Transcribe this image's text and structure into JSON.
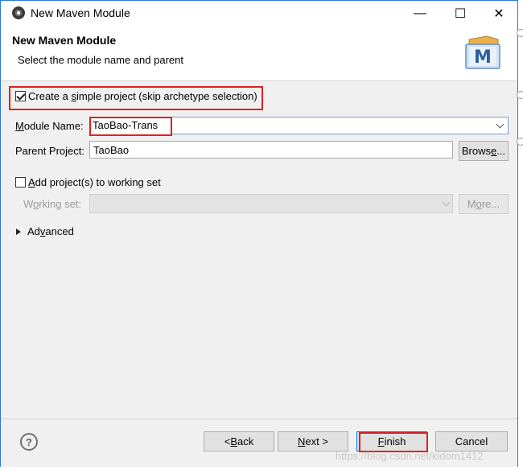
{
  "window": {
    "title": "New Maven Module",
    "controls": {
      "minimize": "—",
      "maximize": "☐",
      "close": "✕"
    }
  },
  "header": {
    "title": "New Maven Module",
    "description": "Select the module name and parent",
    "logo_letter": "M"
  },
  "form": {
    "simple_project": {
      "prefix": "Create a ",
      "mnemonic": "s",
      "suffix": "imple project (skip archetype selection)",
      "checked": true
    },
    "module_name": {
      "mnemonic": "M",
      "label_rest": "odule Name:",
      "value": "TaoBao-Trans"
    },
    "parent_project": {
      "label": "Parent Project:",
      "value": "TaoBao"
    },
    "browse_button": {
      "prefix": "Brows",
      "mnemonic": "e",
      "suffix": "..."
    },
    "working_set_checkbox": {
      "mnemonic": "A",
      "label_rest": "dd project(s) to working set",
      "checked": false
    },
    "working_set": {
      "prefix": "W",
      "mnemonic": "o",
      "suffix": "rking set:"
    },
    "more_button": {
      "prefix": "M",
      "mnemonic": "o",
      "suffix": "re..."
    },
    "advanced": {
      "prefix": "Ad",
      "mnemonic": "v",
      "suffix": "anced"
    }
  },
  "footer": {
    "help": "?",
    "back": {
      "prefix": "< ",
      "mnemonic": "B",
      "suffix": "ack"
    },
    "next": {
      "mnemonic": "N",
      "suffix": "ext >"
    },
    "finish": {
      "mnemonic": "F",
      "suffix": "inish"
    },
    "cancel": "Cancel"
  },
  "watermark": "https://blog.csdn.net/kidom1412",
  "colors": {
    "highlight": "#e02020",
    "focus_border": "#7a9cd3",
    "window_border": "#2b79d8"
  }
}
